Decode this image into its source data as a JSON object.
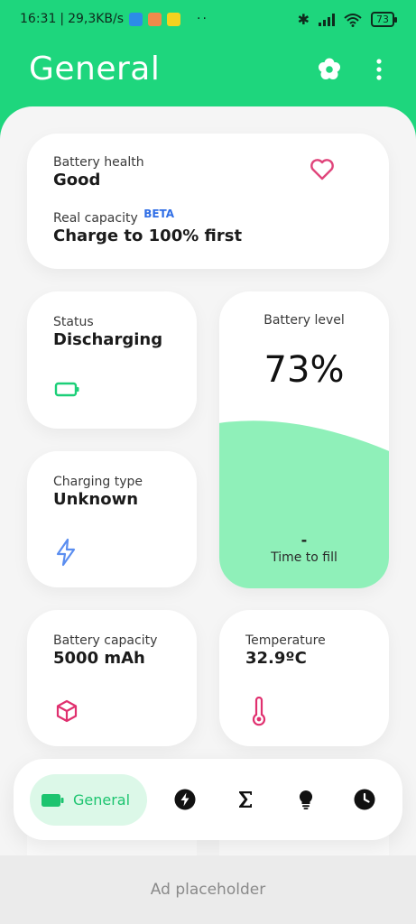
{
  "status_bar": {
    "time": "16:31",
    "network_speed": "29,3KB/s",
    "battery_percent": "73",
    "more_indicator": "··"
  },
  "app_bar": {
    "title": "General",
    "settings_icon": "flower-gear-icon",
    "more_icon": "more-vert-icon"
  },
  "cards": {
    "battery_health": {
      "label": "Battery health",
      "value": "Good",
      "icon": "heart-icon"
    },
    "real_capacity": {
      "label": "Real capacity",
      "badge": "BETA",
      "value": "Charge to 100% first"
    },
    "status": {
      "label": "Status",
      "value": "Discharging",
      "icon": "battery-icon"
    },
    "battery_level": {
      "label": "Battery level",
      "value": "73%",
      "level_fraction": 0.73,
      "fill_value": "-",
      "fill_label": "Time to fill"
    },
    "charging_type": {
      "label": "Charging type",
      "value": "Unknown",
      "icon": "lightning-icon"
    },
    "battery_capacity": {
      "label": "Battery capacity",
      "value": "5000 mAh",
      "icon": "cube-icon"
    },
    "temperature": {
      "label": "Temperature",
      "value": "32.9ºC",
      "icon": "thermometer-icon"
    }
  },
  "bottom_nav": {
    "active_label": "General",
    "items": [
      "battery-icon",
      "bolt-circle-icon",
      "sigma-icon",
      "bulb-icon",
      "clock-icon"
    ]
  },
  "ad": {
    "text": "Ad placeholder"
  },
  "colors": {
    "accent": "#1ed67d",
    "level_fill": "#8ff0b9",
    "beta": "#2f6ee6",
    "heart": "#e0457b",
    "cube": "#e0306f",
    "lightning": "#5b8ef0"
  }
}
